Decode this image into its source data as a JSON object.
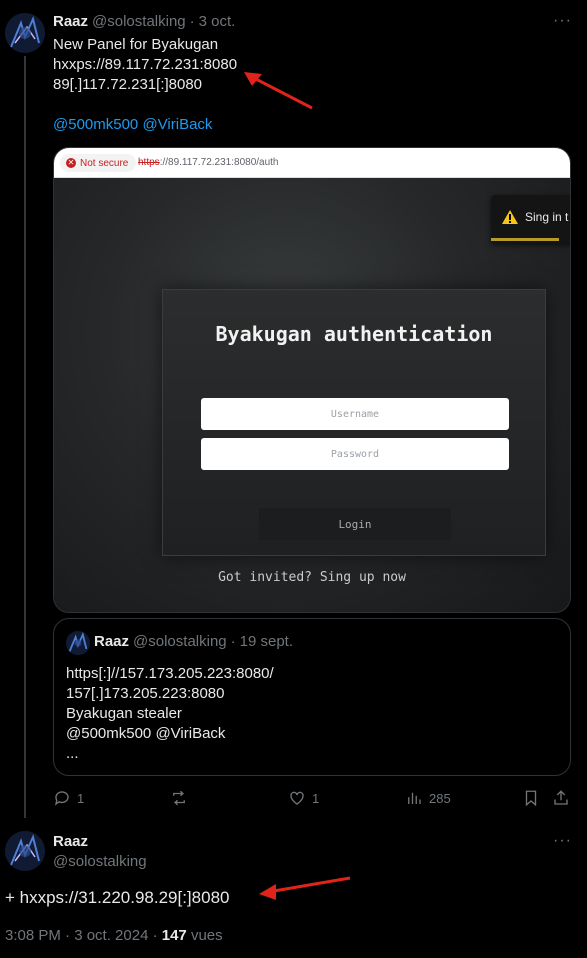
{
  "tweet1": {
    "name": "Raaz",
    "handle": "@solostalking",
    "date": "3 oct.",
    "lines": [
      "New Panel for Byakugan",
      "hxxps://89.117.72.231:8080",
      "89[.]117.72.231[:]8080"
    ],
    "mentions": "@500mk500 @ViriBack",
    "more": "···"
  },
  "screenshot": {
    "not_secure": "Not secure",
    "url_scheme": "https",
    "url_rest": "://89.117.72.231:8080/auth",
    "toast_text": "Sing in t",
    "panel_title": "Byakugan authentication",
    "username_placeholder": "Username",
    "password_placeholder": "Password",
    "login_label": "Login",
    "invite_text": "Got invited? Sing up now"
  },
  "quote": {
    "name": "Raaz",
    "handle": "@solostalking",
    "date": "19 sept.",
    "lines": [
      "https[:]//157.173.205.223:8080/",
      "157[.]173.205.223:8080",
      "Byakugan stealer",
      "@500mk500 @ViriBack",
      "..."
    ]
  },
  "actions": {
    "replies": "1",
    "reposts": "",
    "likes": "1",
    "views": "285"
  },
  "tweet2": {
    "name": "Raaz",
    "handle": "@solostalking",
    "text": "+ hxxps://31.220.98.29[:]8080",
    "time": "3:08 PM · 3 oct. 2024 · ",
    "views_count": "147",
    "views_label": " vues",
    "more": "···"
  },
  "colors": {
    "accent": "#1d9bf0",
    "annotation_arrow": "#e0241b"
  }
}
